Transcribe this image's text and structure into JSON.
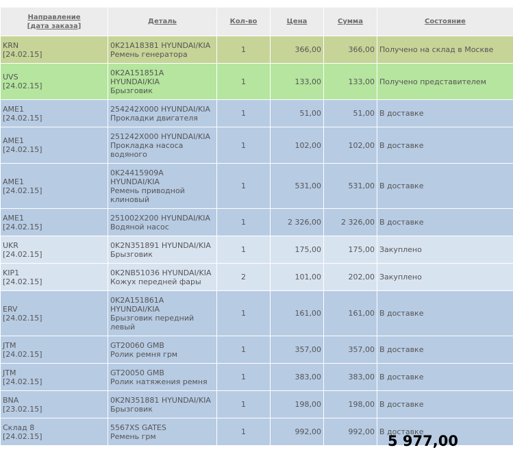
{
  "header": {
    "direction_label": "Направление",
    "direction_sub": "[дата заказа]",
    "detail_label": "Деталь",
    "qty_label": "Кол-во",
    "price_label": "Цена",
    "sum_label": "Сумма",
    "status_label": "Состояние"
  },
  "colors": {
    "received_moscow": "#c6d498",
    "received_rep": "#b5e59e",
    "in_delivery": "#b7cbe3",
    "bought": "#d8e3f0"
  },
  "rows": [
    {
      "dir": "KRN",
      "date": "[24.02.15]",
      "detail": "0K21A18381 HYUNDAI/KIA\nРемень генератора",
      "qty": "1",
      "price": "366,00",
      "sum": "366,00",
      "status": "Получено на склад в Москве",
      "state": "received_moscow"
    },
    {
      "dir": "UVS",
      "date": "[24.02.15]",
      "detail": "0K2A151851A\nHYUNDAI/KIA\nБрызговик",
      "qty": "1",
      "price": "133,00",
      "sum": "133,00",
      "status": "Получено представителем",
      "state": "received_rep"
    },
    {
      "dir": "AME1",
      "date": "[24.02.15]",
      "detail": "254242X000 HYUNDAI/KIA\nПрокладки двигателя",
      "qty": "1",
      "price": "51,00",
      "sum": "51,00",
      "status": "В доставке",
      "state": "in_delivery"
    },
    {
      "dir": "AME1",
      "date": "[24.02.15]",
      "detail": "251242X000 HYUNDAI/KIA\nПрокладка насоса\nводяного",
      "qty": "1",
      "price": "102,00",
      "sum": "102,00",
      "status": "В доставке",
      "state": "in_delivery"
    },
    {
      "dir": "AME1",
      "date": "[24.02.15]",
      "detail": "0K24415909A\nHYUNDAI/KIA\nРемень приводной\nклиновый",
      "qty": "1",
      "price": "531,00",
      "sum": "531,00",
      "status": "В доставке",
      "state": "in_delivery"
    },
    {
      "dir": "AME1",
      "date": "[24.02.15]",
      "detail": "251002X200 HYUNDAI/KIA\nВодяной насос",
      "qty": "1",
      "price": "2 326,00",
      "sum": "2 326,00",
      "status": "В доставке",
      "state": "in_delivery"
    },
    {
      "dir": "UKR",
      "date": "[24.02.15]",
      "detail": "0K2N351891 HYUNDAI/KIA\nБрызговик",
      "qty": "1",
      "price": "175,00",
      "sum": "175,00",
      "status": "Закуплено",
      "state": "bought"
    },
    {
      "dir": "KIP1",
      "date": "[24.02.15]",
      "detail": "0K2NB51036 HYUNDAI/KIA\nКожух передней фары",
      "qty": "2",
      "price": "101,00",
      "sum": "202,00",
      "status": "Закуплено",
      "state": "bought"
    },
    {
      "dir": "ERV",
      "date": "[24.02.15]",
      "detail": "0K2A151861A\nHYUNDAI/KIA\nБрызговик передний\nлевый",
      "qty": "1",
      "price": "161,00",
      "sum": "161,00",
      "status": "В доставке",
      "state": "in_delivery"
    },
    {
      "dir": "JTM",
      "date": "[24.02.15]",
      "detail": "GT20060 GMB\nРолик ремня грм",
      "qty": "1",
      "price": "357,00",
      "sum": "357,00",
      "status": "В доставке",
      "state": "in_delivery"
    },
    {
      "dir": "JTM",
      "date": "[24.02.15]",
      "detail": "GT20050 GMB\nРолик натяжения ремня",
      "qty": "1",
      "price": "383,00",
      "sum": "383,00",
      "status": "В доставке",
      "state": "in_delivery"
    },
    {
      "dir": "BNA",
      "date": "[23.02.15]",
      "detail": "0K2N351881 HYUNDAI/KIA\nБрызговик",
      "qty": "1",
      "price": "198,00",
      "sum": "198,00",
      "status": "В доставке",
      "state": "in_delivery"
    },
    {
      "dir": "Склад 8",
      "date": "[24.02.15]",
      "detail": "5567XS GATES\nРемень грм",
      "qty": "1",
      "price": "992,00",
      "sum": "992,00",
      "status": "В доставке",
      "state": "in_delivery"
    }
  ],
  "total": "5 977,00"
}
